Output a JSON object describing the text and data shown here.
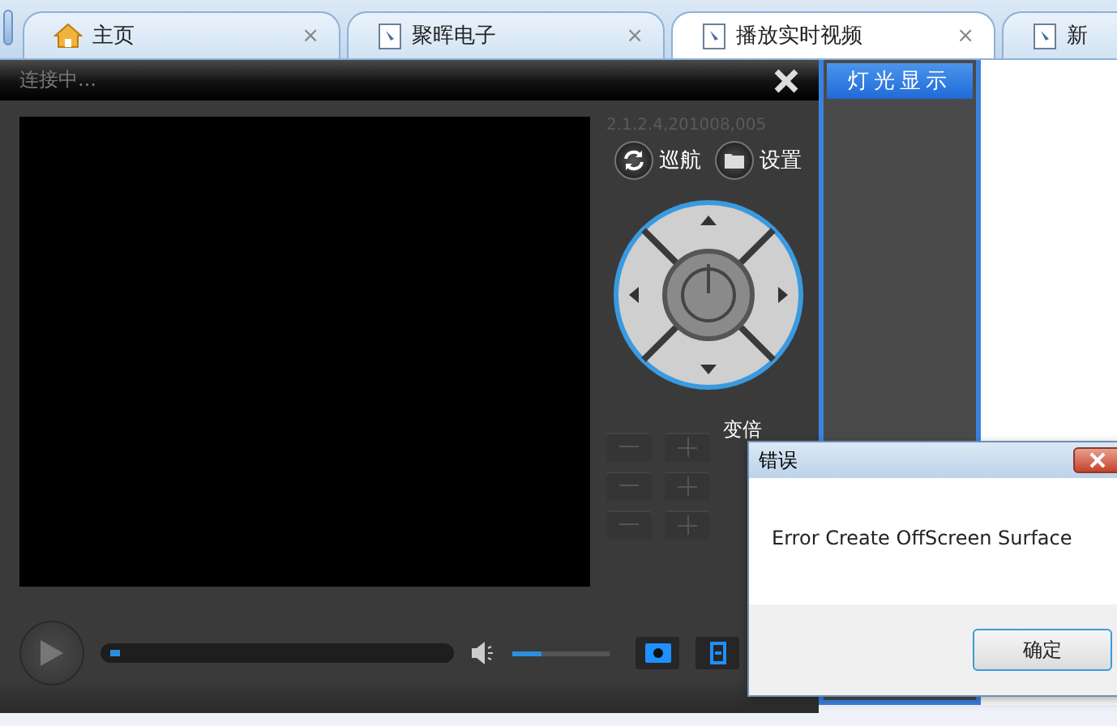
{
  "tabs": [
    {
      "label": "主页",
      "selected": false,
      "close": "×"
    },
    {
      "label": "聚晖电子",
      "selected": false,
      "close": "×"
    },
    {
      "label": "播放实时视频",
      "selected": true,
      "close": "×"
    },
    {
      "label": "新",
      "selected": false
    }
  ],
  "player": {
    "status": "连接中...",
    "version": "2.1.2.4,201008,005",
    "buttons": [
      {
        "label": "巡航"
      },
      {
        "label": "设置"
      }
    ],
    "zoom_label": "变倍",
    "progress": {
      "level": 0.02
    },
    "volume": {
      "level": 0.3
    }
  },
  "side_panel": {
    "title": "灯光显示"
  },
  "dialog": {
    "title": "错误",
    "message": "Error Create OffScreen Surface",
    "button": "确定"
  }
}
